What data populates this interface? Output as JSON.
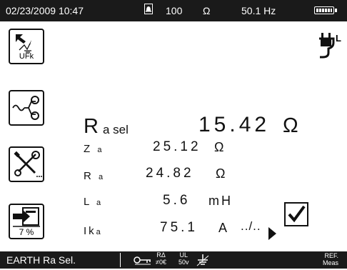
{
  "status_bar": {
    "datetime": "02/23/2009 10:47",
    "resistance_value": "100",
    "resistance_unit": "Ω",
    "frequency": "50.1 Hz",
    "icons": [
      "bell-icon",
      "battery-icon"
    ]
  },
  "side_buttons": [
    {
      "name": "ufk-button",
      "icon": "fault-voltage-icon",
      "label": "UFk"
    },
    {
      "name": "loop-button",
      "icon": "loop-probe-icon",
      "label": ""
    },
    {
      "name": "tools-button",
      "icon": "tools-icon",
      "label": ""
    },
    {
      "name": "export-button",
      "icon": "export-icon",
      "label": "7 %"
    }
  ],
  "plug_indicator": {
    "icon": "plug-icon",
    "label": "L"
  },
  "main_reading": {
    "label": "R",
    "label_sub": "a sel",
    "value": "15.42",
    "unit": "Ω"
  },
  "readings": [
    {
      "label": "Z",
      "sub": "a",
      "value": "25.12",
      "unit": "Ω"
    },
    {
      "label": "R",
      "sub": "a",
      "value": "24.82",
      "unit": "Ω"
    },
    {
      "label": "L",
      "sub": "a",
      "value": "5.6",
      "unit": "mH"
    },
    {
      "label": "Ik",
      "sub": "a",
      "value": "75.1",
      "unit": "A"
    }
  ],
  "more_text": "../..",
  "checkbox_checked": true,
  "bottom_bar": {
    "mode": "EARTH Ra Sel.",
    "icons": [
      "key-icon",
      "ra-zero-icon",
      "ul-50v-icon",
      "earth-icon"
    ],
    "ul_top": "UL",
    "ul_bottom": "50v",
    "ra_top": "RΔ",
    "ra_bottom": "≠0€",
    "ref_top": "REF.",
    "ref_bottom": "Meas"
  },
  "colors": {
    "bar_background": "#1a1a1a",
    "bar_text": "#ffffff",
    "content_text": "#111111"
  }
}
